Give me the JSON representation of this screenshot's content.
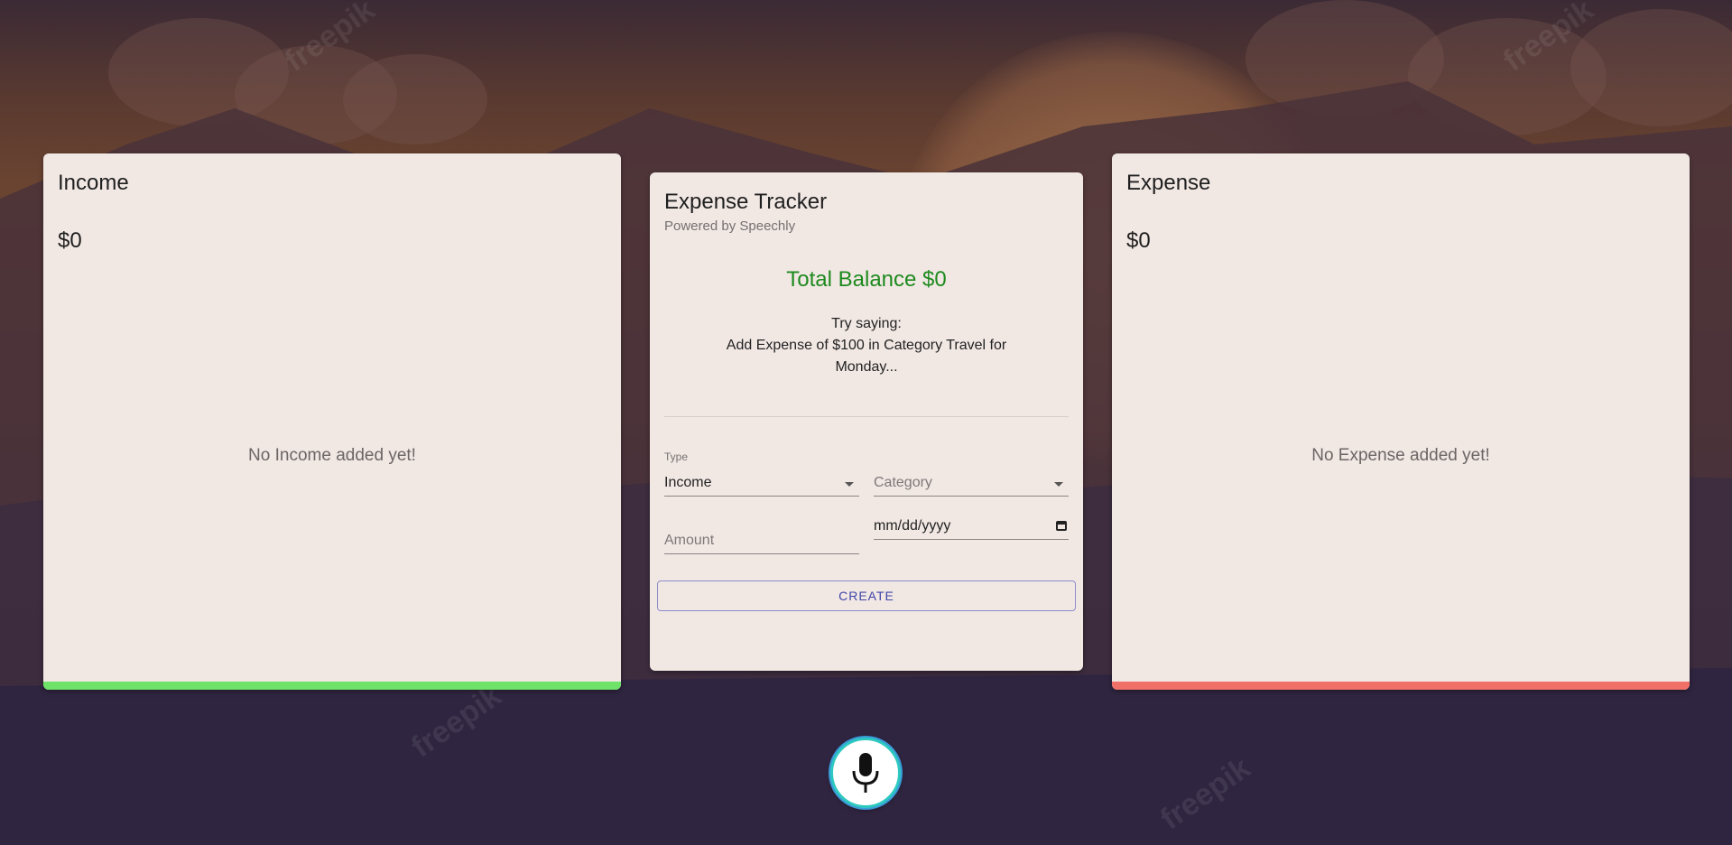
{
  "colors": {
    "income_accent": "#6fe26a",
    "expense_accent": "#f07067",
    "balance_text": "#1e8a1e",
    "button_text": "#3f44a8",
    "mic_ring": "#2dc8c0"
  },
  "income": {
    "title": "Income",
    "amount": "$0",
    "empty_text": "No Income added yet!"
  },
  "expense": {
    "title": "Expense",
    "amount": "$0",
    "empty_text": "No Expense added yet!"
  },
  "tracker": {
    "title": "Expense Tracker",
    "subtitle": "Powered by Speechly",
    "balance": "Total Balance $0",
    "hint_line1": "Try saying:",
    "hint_line2": "Add Expense of $100 in Category Travel for Monday...",
    "form": {
      "type_label": "Type",
      "type_value": "Income",
      "category_placeholder": "Category",
      "amount_placeholder": "Amount",
      "date_placeholder": "mm/dd/yyyy",
      "create_label": "CREATE"
    }
  },
  "icons": {
    "mic": "microphone-icon",
    "calendar": "calendar-icon",
    "dropdown": "chevron-down-icon"
  }
}
